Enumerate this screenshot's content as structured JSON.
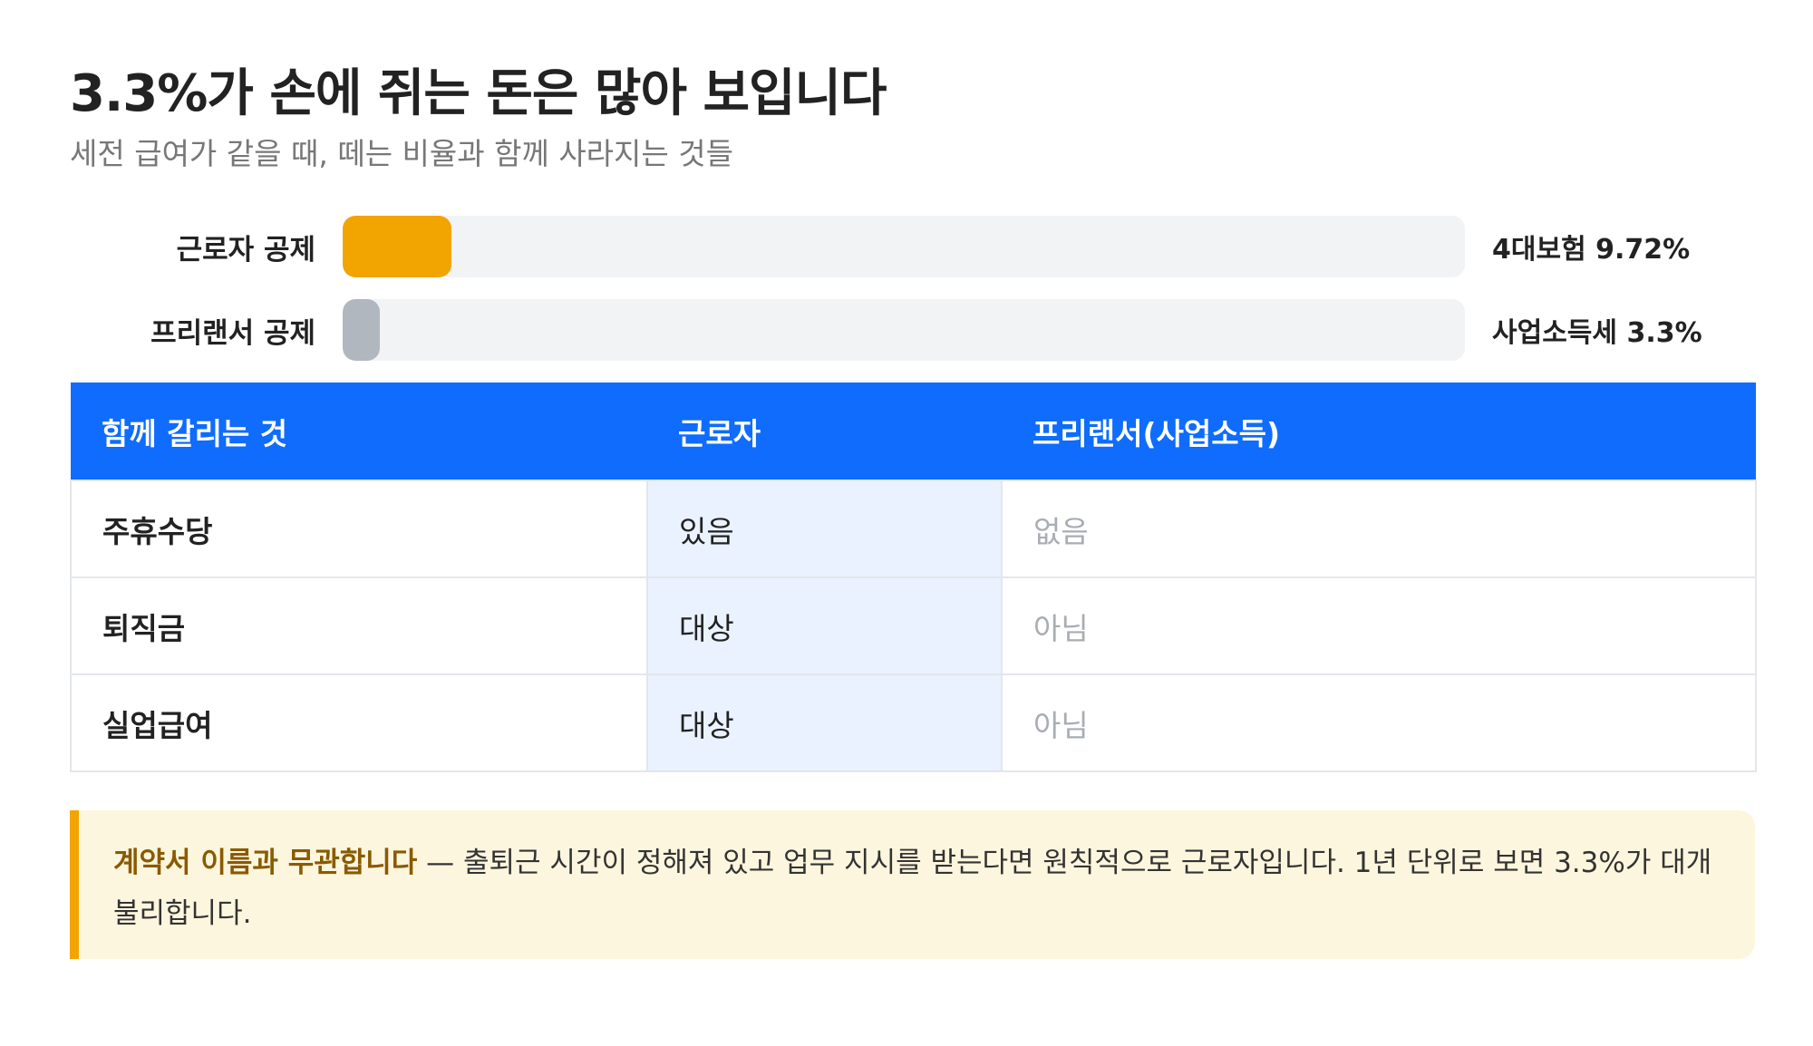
{
  "header": {
    "title": "3.3%가 손에 쥐는 돈은 많아 보입니다",
    "subtitle": "세전 급여가 같을 때, 떼는 비율과 함께 사라지는 것들"
  },
  "bars": [
    {
      "label": "근로자 공제",
      "value_text": "4대보험 9.72%",
      "percent": 9.72,
      "color": "#f2a400"
    },
    {
      "label": "프리랜서 공제",
      "value_text": "사업소득세 3.3%",
      "percent": 3.3,
      "color": "#b1b7be"
    }
  ],
  "table": {
    "headers": [
      "함께 갈리는 것",
      "근로자",
      "프리랜서(사업소득)"
    ],
    "rows": [
      [
        "주휴수당",
        "있음",
        "없음"
      ],
      [
        "퇴직금",
        "대상",
        "아님"
      ],
      [
        "실업급여",
        "대상",
        "아님"
      ]
    ]
  },
  "note": {
    "strong": "계약서 이름과 무관합니다",
    "text": " — 출퇴근 시간이 정해져 있고 업무 지시를 받는다면 원칙적으로 근로자입니다. 1년 단위로 보면 3.3%가 대개 불리합니다."
  },
  "colors": {
    "accent_blue": "#0f6cfd",
    "worker_bar": "#f2a400",
    "freelancer_bar": "#b1b7be",
    "note_border": "#f2a400",
    "note_background": "#fdf6de"
  }
}
